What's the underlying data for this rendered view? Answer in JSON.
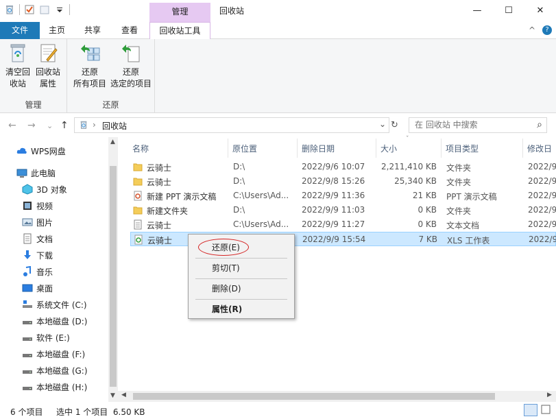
{
  "window": {
    "context_tab": "管理",
    "title": "回收站",
    "minimize": "—",
    "maximize": "☐",
    "close": "✕"
  },
  "tabs": {
    "file": "文件",
    "home": "主页",
    "share": "共享",
    "view": "查看",
    "recycle_tools": "回收站工具",
    "caret": "^",
    "help": "?"
  },
  "ribbon": {
    "group_manage": {
      "label": "管理",
      "empty_line1": "清空回",
      "empty_line2": "收站",
      "props_line1": "回收站",
      "props_line2": "属性"
    },
    "group_restore": {
      "label": "还原",
      "restore_all_line1": "还原",
      "restore_all_line2": "所有项目",
      "restore_sel_line1": "还原",
      "restore_sel_line2": "选定的项目"
    }
  },
  "address": {
    "back": "←",
    "forward": "→",
    "recent": "⌄",
    "up": "↑",
    "path": "回收站",
    "dropdown": "⌄",
    "refresh": "↻",
    "search_placeholder": "在 回收站 中搜索",
    "search_icon": "⌕"
  },
  "navpane": {
    "items": [
      {
        "label": "WPS网盘",
        "icon": "cloud-icon"
      },
      {
        "label": "此电脑",
        "icon": "computer-icon"
      },
      {
        "label": "3D 对象",
        "icon": "3d-object-icon"
      },
      {
        "label": "视频",
        "icon": "video-icon"
      },
      {
        "label": "图片",
        "icon": "picture-icon"
      },
      {
        "label": "文档",
        "icon": "document-icon"
      },
      {
        "label": "下载",
        "icon": "download-icon"
      },
      {
        "label": "音乐",
        "icon": "music-icon"
      },
      {
        "label": "桌面",
        "icon": "desktop-icon"
      },
      {
        "label": "系统文件 (C:)",
        "icon": "drive-icon"
      },
      {
        "label": "本地磁盘 (D:)",
        "icon": "drive-icon"
      },
      {
        "label": "软件 (E:)",
        "icon": "drive-icon"
      },
      {
        "label": "本地磁盘 (F:)",
        "icon": "drive-icon"
      },
      {
        "label": "本地磁盘 (G:)",
        "icon": "drive-icon"
      },
      {
        "label": "本地磁盘 (H:)",
        "icon": "drive-icon"
      }
    ]
  },
  "columns": {
    "name": "名称",
    "origin": "原位置",
    "deleted": "删除日期",
    "size": "大小",
    "type": "项目类型",
    "modified": "修改日"
  },
  "files": [
    {
      "name": "云骑士",
      "origin": "D:\\",
      "deleted": "2022/9/6 10:07",
      "size": "2,211,410 KB",
      "type": "文件夹",
      "modified": "2022/9",
      "icon": "folder-icon"
    },
    {
      "name": "云骑士",
      "origin": "D:\\",
      "deleted": "2022/9/8 15:26",
      "size": "25,340 KB",
      "type": "文件夹",
      "modified": "2022/9",
      "icon": "folder-icon"
    },
    {
      "name": "新建 PPT 演示文稿",
      "origin": "C:\\Users\\Ad...",
      "deleted": "2022/9/9 11:36",
      "size": "21 KB",
      "type": "PPT 演示文稿",
      "modified": "2022/9",
      "icon": "ppt-file-icon"
    },
    {
      "name": "新建文件夹",
      "origin": "D:\\",
      "deleted": "2022/9/9 11:03",
      "size": "0 KB",
      "type": "文件夹",
      "modified": "2022/9",
      "icon": "folder-icon"
    },
    {
      "name": "云骑士",
      "origin": "C:\\Users\\Ad...",
      "deleted": "2022/9/9 11:27",
      "size": "0 KB",
      "type": "文本文档",
      "modified": "2022/9",
      "icon": "text-file-icon"
    },
    {
      "name": "云骑士",
      "origin": "",
      "deleted": "2022/9/9 15:54",
      "size": "7 KB",
      "type": "XLS 工作表",
      "modified": "2022/9",
      "icon": "xls-file-icon"
    }
  ],
  "context_menu": {
    "restore": "还原(E)",
    "cut": "剪切(T)",
    "delete": "删除(D)",
    "properties": "属性(R)"
  },
  "status": {
    "count": "6 个项目",
    "selected": "选中 1 个项目  6.50 KB"
  },
  "colors": {
    "accent": "#1e7ab8",
    "context_tab": "#e6c9f2",
    "selection": "#cce8ff",
    "annotation_ring": "#d42020"
  }
}
